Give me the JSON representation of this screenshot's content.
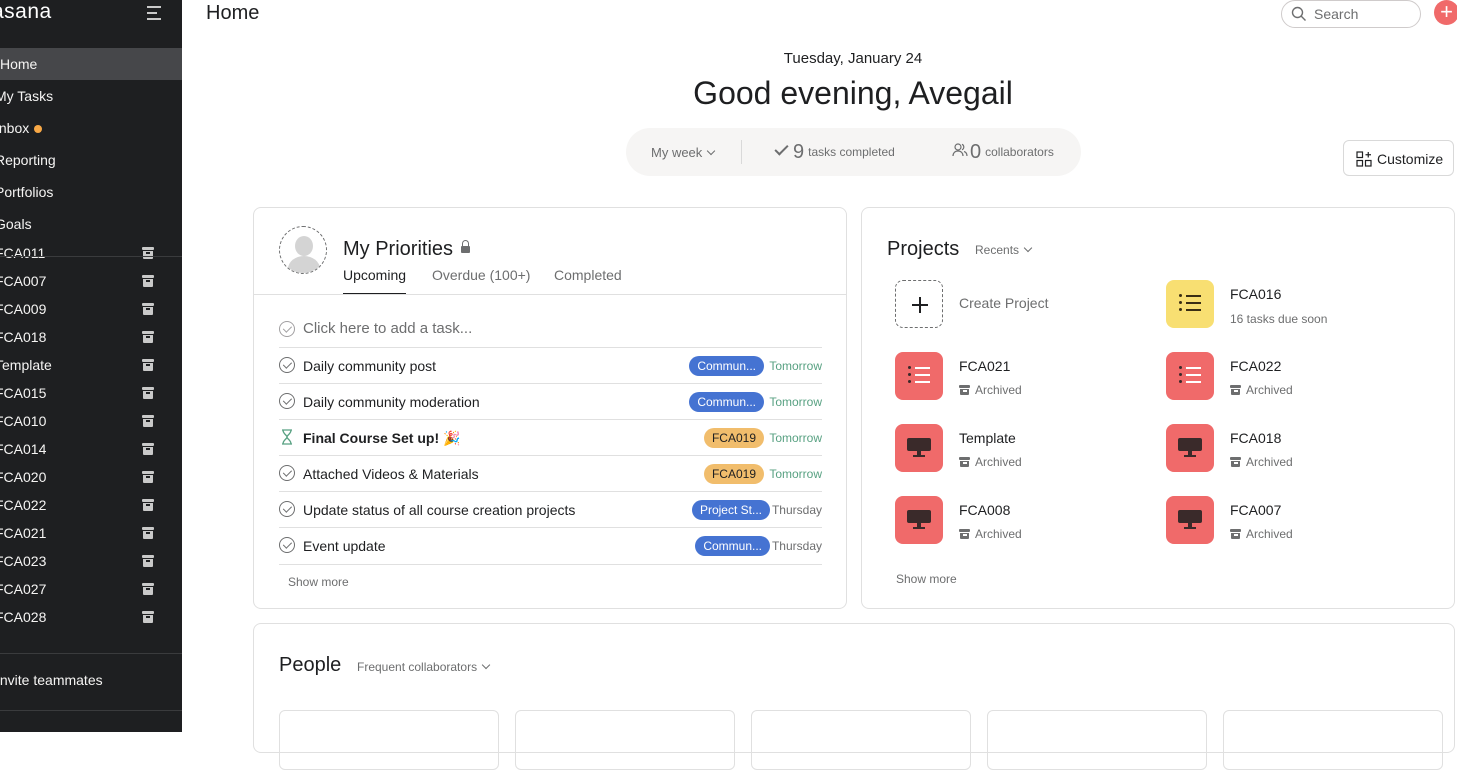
{
  "app": {
    "logo": "asana"
  },
  "sidebar": {
    "nav": [
      {
        "label": "Home",
        "active": true
      },
      {
        "label": "My Tasks"
      },
      {
        "label": "Inbox",
        "dot": true
      },
      {
        "label": "Reporting"
      },
      {
        "label": "Portfolios"
      },
      {
        "label": "Goals"
      }
    ],
    "projects": [
      "FCA011",
      "FCA007",
      "FCA009",
      "FCA018",
      "Template",
      "FCA015",
      "FCA010",
      "FCA014",
      "FCA020",
      "FCA022",
      "FCA021",
      "FCA023",
      "FCA027",
      "FCA028"
    ],
    "invite": "Invite teammates"
  },
  "header": {
    "title": "Home",
    "search_placeholder": "Search",
    "add_label": "+"
  },
  "greeting": {
    "date": "Tuesday, January 24",
    "text": "Good evening, Avegail"
  },
  "stats": {
    "period": "My week",
    "tasks_completed_count": "9",
    "tasks_completed_label": "tasks completed",
    "collaborators_count": "0",
    "collaborators_label": "collaborators"
  },
  "customize_label": "Customize",
  "priorities": {
    "title": "My Priorities",
    "tabs": [
      "Upcoming",
      "Overdue (100+)",
      "Completed"
    ],
    "add_task": "Click here to add a task...",
    "tasks": [
      {
        "name": "Daily community post",
        "tag": "Commun...",
        "tag_color": "blue",
        "due": "Tomorrow",
        "due_color": "green",
        "bold": false,
        "icon": "check-circle"
      },
      {
        "name": "Daily community moderation",
        "tag": "Commun...",
        "tag_color": "blue",
        "due": "Tomorrow",
        "due_color": "green",
        "bold": false,
        "icon": "check-circle"
      },
      {
        "name": "Final Course Set up! 🎉",
        "tag": "FCA019",
        "tag_color": "orange",
        "due": "Tomorrow",
        "due_color": "green",
        "bold": true,
        "icon": "hourglass"
      },
      {
        "name": "Attached Videos & Materials",
        "tag": "FCA019",
        "tag_color": "orange",
        "due": "Tomorrow",
        "due_color": "green",
        "bold": false,
        "icon": "check-circle"
      },
      {
        "name": "Update status of all course creation projects",
        "tag": "Project St...",
        "tag_color": "blue",
        "due": "Thursday",
        "due_color": "grey",
        "bold": false,
        "icon": "check-circle"
      },
      {
        "name": "Event update",
        "tag": "Commun...",
        "tag_color": "blue",
        "due": "Thursday",
        "due_color": "grey",
        "bold": false,
        "icon": "check-circle"
      }
    ],
    "show_more": "Show more"
  },
  "projects": {
    "title": "Projects",
    "filter": "Recents",
    "create_label": "Create Project",
    "items": [
      {
        "name": "FCA016",
        "sub": "16 tasks due soon",
        "color": "yellow",
        "icon": "list-icon",
        "archived": false
      },
      {
        "name": "FCA021",
        "sub": "Archived",
        "color": "red",
        "icon": "list-icon",
        "archived": true
      },
      {
        "name": "FCA022",
        "sub": "Archived",
        "color": "red",
        "icon": "list-icon",
        "archived": true
      },
      {
        "name": "Template",
        "sub": "Archived",
        "color": "red",
        "icon": "monitor-icon",
        "archived": true
      },
      {
        "name": "FCA018",
        "sub": "Archived",
        "color": "red",
        "icon": "monitor-icon",
        "archived": true
      },
      {
        "name": "FCA008",
        "sub": "Archived",
        "color": "red",
        "icon": "monitor-icon",
        "archived": true
      },
      {
        "name": "FCA007",
        "sub": "Archived",
        "color": "red",
        "icon": "monitor-icon",
        "archived": true
      }
    ],
    "show_more": "Show more"
  },
  "people": {
    "title": "People",
    "filter": "Frequent collaborators"
  },
  "colors": {
    "sidebar_bg": "#1e1f21",
    "accent_red": "#f06a6a",
    "tag_blue": "#4573d2",
    "tag_orange": "#f1bd6c",
    "due_green": "#58a182"
  }
}
